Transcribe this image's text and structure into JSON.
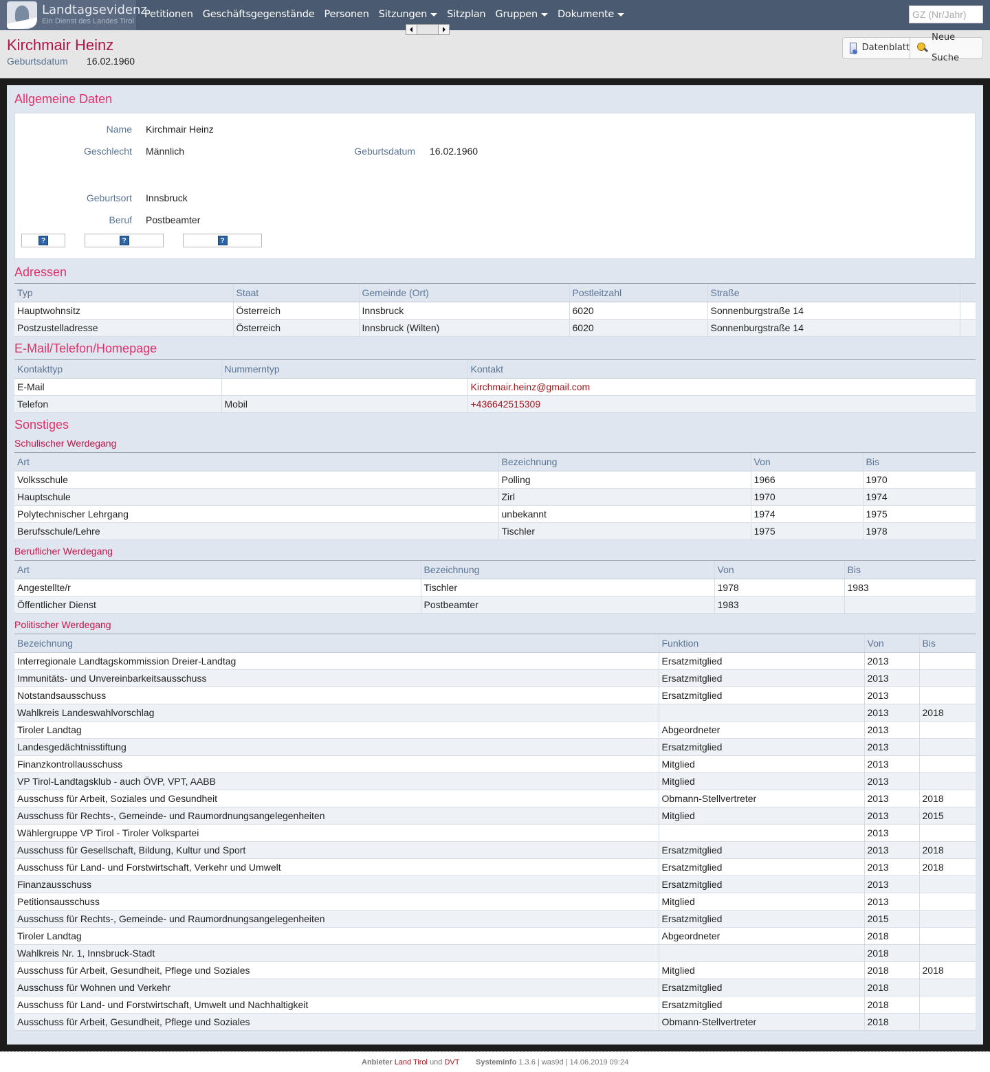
{
  "brand": {
    "title": "Landtagsevidenz",
    "subtitle": "Ein Dienst des Landes Tirol"
  },
  "nav": [
    {
      "label": "Petitionen",
      "dropdown": false
    },
    {
      "label": "Geschäftsgegenstände",
      "dropdown": false
    },
    {
      "label": "Personen",
      "dropdown": false
    },
    {
      "label": "Sitzungen",
      "dropdown": true
    },
    {
      "label": "Sitzplan",
      "dropdown": false
    },
    {
      "label": "Gruppen",
      "dropdown": true
    },
    {
      "label": "Dokumente",
      "dropdown": true
    }
  ],
  "search": {
    "placeholder": "GZ (Nr/Jahr)"
  },
  "header": {
    "name": "Kirchmair Heinz",
    "birth_label": "Geburtsdatum",
    "birth_value": "16.02.1960",
    "btn_datenblatt": "Datenblatt",
    "btn_neue_suche": "Neue Suche"
  },
  "allgemein": {
    "title": "Allgemeine Daten",
    "name_label": "Name",
    "name_value": "Kirchmair Heinz",
    "gender_label": "Geschlecht",
    "gender_value": "Männlich",
    "birth_label": "Geburtsdatum",
    "birth_value": "16.02.1960",
    "place_label": "Geburtsort",
    "place_value": "Innsbruck",
    "job_label": "Beruf",
    "job_value": "Postbeamter",
    "help_glyph": "?"
  },
  "adressen": {
    "title": "Adressen",
    "columns": [
      "Typ",
      "Staat",
      "Gemeinde (Ort)",
      "Postleitzahl",
      "Straße"
    ],
    "rows": [
      [
        "Hauptwohnsitz",
        "Österreich",
        "Innsbruck",
        "6020",
        "Sonnenburgstraße 14"
      ],
      [
        "Postzustelladresse",
        "Österreich",
        "Innsbruck (Wilten)",
        "6020",
        "Sonnenburgstraße 14"
      ]
    ]
  },
  "kontakt": {
    "title": "E-Mail/Telefon/Homepage",
    "columns": [
      "Kontakttyp",
      "Nummerntyp",
      "Kontakt"
    ],
    "rows": [
      [
        "E-Mail",
        "",
        "Kirchmair.heinz@gmail.com"
      ],
      [
        "Telefon",
        "Mobil",
        "+436642515309"
      ]
    ]
  },
  "sonstiges": {
    "title": "Sonstiges",
    "schule": {
      "title": "Schulischer Werdegang",
      "columns": [
        "Art",
        "Bezeichnung",
        "Von",
        "Bis"
      ],
      "rows": [
        [
          "Volksschule",
          "Polling",
          "1966",
          "1970"
        ],
        [
          "Hauptschule",
          "Zirl",
          "1970",
          "1974"
        ],
        [
          "Polytechnischer Lehrgang",
          "unbekannt",
          "1974",
          "1975"
        ],
        [
          "Berufsschule/Lehre",
          "Tischler",
          "1975",
          "1978"
        ]
      ]
    },
    "beruf": {
      "title": "Beruflicher Werdegang",
      "columns": [
        "Art",
        "Bezeichnung",
        "Von",
        "Bis"
      ],
      "rows": [
        [
          "Angestellte/r",
          "Tischler",
          "1978",
          "1983"
        ],
        [
          "Öffentlicher Dienst",
          "Postbeamter",
          "1983",
          ""
        ]
      ]
    },
    "politik": {
      "title": "Politischer Werdegang",
      "columns": [
        "Bezeichnung",
        "Funktion",
        "Von",
        "Bis"
      ],
      "rows": [
        [
          "Interregionale Landtagskommission Dreier-Landtag",
          "Ersatzmitglied",
          "2013",
          ""
        ],
        [
          "Immunitäts- und Unvereinbarkeitsausschuss",
          "Ersatzmitglied",
          "2013",
          ""
        ],
        [
          "Notstandsausschuss",
          "Ersatzmitglied",
          "2013",
          ""
        ],
        [
          "Wahlkreis Landeswahlvorschlag",
          "",
          "2013",
          "2018"
        ],
        [
          "Tiroler Landtag",
          "Abgeordneter",
          "2013",
          ""
        ],
        [
          "Landesgedächtnisstiftung",
          "Ersatzmitglied",
          "2013",
          ""
        ],
        [
          "Finanzkontrollausschuss",
          "Mitglied",
          "2013",
          ""
        ],
        [
          "VP Tirol-Landtagsklub - auch ÖVP, VPT, AABB",
          "Mitglied",
          "2013",
          ""
        ],
        [
          "Ausschuss für Arbeit, Soziales und Gesundheit",
          "Obmann-Stellvertreter",
          "2013",
          "2018"
        ],
        [
          "Ausschuss für Rechts-, Gemeinde- und Raumordnungsangelegenheiten",
          "Mitglied",
          "2013",
          "2015"
        ],
        [
          "Wählergruppe VP Tirol - Tiroler Volkspartei",
          "",
          "2013",
          ""
        ],
        [
          "Ausschuss für Gesellschaft, Bildung, Kultur und Sport",
          "Ersatzmitglied",
          "2013",
          "2018"
        ],
        [
          "Ausschuss für Land- und Forstwirtschaft, Verkehr und Umwelt",
          "Ersatzmitglied",
          "2013",
          "2018"
        ],
        [
          "Finanzausschuss",
          "Ersatzmitglied",
          "2013",
          ""
        ],
        [
          "Petitionsausschuss",
          "Mitglied",
          "2013",
          ""
        ],
        [
          "Ausschuss für Rechts-, Gemeinde- und Raumordnungsangelegenheiten",
          "Ersatzmitglied",
          "2015",
          ""
        ],
        [
          "Tiroler Landtag",
          "Abgeordneter",
          "2018",
          ""
        ],
        [
          "Wahlkreis Nr. 1, Innsbruck-Stadt",
          "",
          "2018",
          ""
        ],
        [
          "Ausschuss für Arbeit, Gesundheit, Pflege und Soziales",
          "Mitglied",
          "2018",
          "2018"
        ],
        [
          "Ausschuss für Wohnen und Verkehr",
          "Ersatzmitglied",
          "2018",
          ""
        ],
        [
          "Ausschuss für Land- und Forstwirtschaft, Umwelt und Nachhaltigkeit",
          "Ersatzmitglied",
          "2018",
          ""
        ],
        [
          "Ausschuss für Arbeit, Gesundheit, Pflege und Soziales",
          "Obmann-Stellvertreter",
          "2018",
          ""
        ]
      ]
    }
  },
  "footer": {
    "anbieter_label": "Anbieter",
    "anbieter_link1": "Land Tirol",
    "und": "und",
    "anbieter_link2": "DVT",
    "systeminfo_label": "Systeminfo",
    "systeminfo_value": "1.3.6 | was9d | 14.06.2019 09:24"
  },
  "colors": {
    "nav_bg": "#4a5a70",
    "title_red": "#b0154a",
    "section_pink": "#e0326a",
    "label_blue": "#5a7494",
    "link_red": "#a0151a"
  },
  "icons": {
    "datenblatt": "document-icon",
    "neue_suche": "search-key-icon",
    "help": "help-icon",
    "scroll_left": "arrow-left-icon",
    "scroll_right": "arrow-right-icon"
  }
}
